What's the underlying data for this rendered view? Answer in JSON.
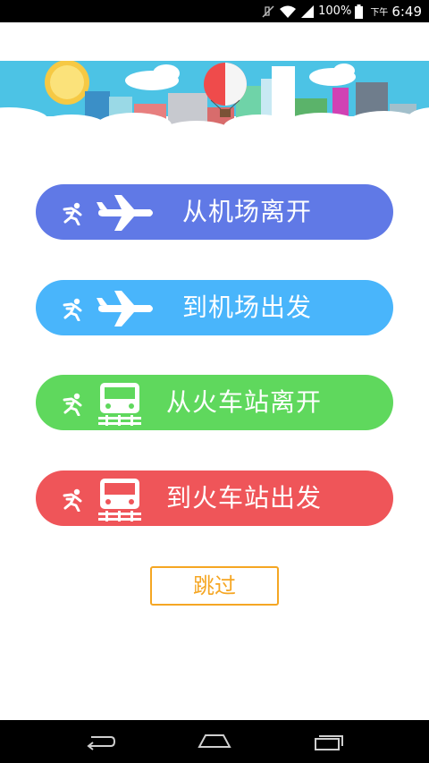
{
  "status_bar": {
    "battery_percent": "100%",
    "ampm": "下午",
    "time": "6:49",
    "icons": [
      "mute-icon",
      "wifi-icon",
      "signal-icon",
      "battery-icon"
    ]
  },
  "banner": {
    "description_icons": [
      "sun-icon",
      "cloud-icon",
      "hot-air-balloon-icon",
      "city-buildings-icon"
    ]
  },
  "actions": [
    {
      "label": "从机场离开",
      "vehicle_icon": "airplane-icon",
      "color": "#6079e6"
    },
    {
      "label": "到机场出发",
      "vehicle_icon": "airplane-icon",
      "color": "#49b5fb"
    },
    {
      "label": "从火车站离开",
      "vehicle_icon": "train-icon",
      "color": "#5fd85d"
    },
    {
      "label": "到火车站出发",
      "vehicle_icon": "train-icon",
      "color": "#ef5559"
    }
  ],
  "skip": {
    "label": "跳过",
    "color": "#f5a623"
  },
  "nav_bar": {
    "icons": [
      "back-icon",
      "home-icon",
      "recent-apps-icon"
    ]
  }
}
